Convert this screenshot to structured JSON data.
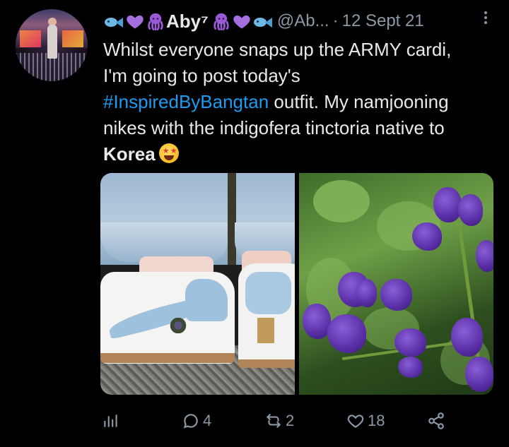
{
  "tweet": {
    "display_name": "Aby⁷",
    "handle": "@Ab...",
    "separator": "·",
    "date": "12 Sept 21",
    "name_emojis": [
      "fish-emoji",
      "purple-heart-emoji",
      "octopus-emoji"
    ],
    "text": {
      "line1": "Whilst everyone snaps up the ARMY  cardi,",
      "line2": "I'm going to post today's",
      "hashtag": "#InspiredByBangtan",
      "after_hashtag": " outfit. My namjooning",
      "line4": "nikes with the indigofera tinctoria native to",
      "bold_word": "Korea"
    },
    "media": [
      {
        "name": "sneakers-photo"
      },
      {
        "name": "indigo-flowers-photo"
      }
    ]
  },
  "actions": {
    "replies": "4",
    "retweets": "2",
    "likes": "18"
  },
  "colors": {
    "background": "#000000",
    "text": "#e7e9ea",
    "muted": "#8b98a5",
    "link": "#1d9bf0",
    "emoji_purple": "#9b59d6"
  }
}
